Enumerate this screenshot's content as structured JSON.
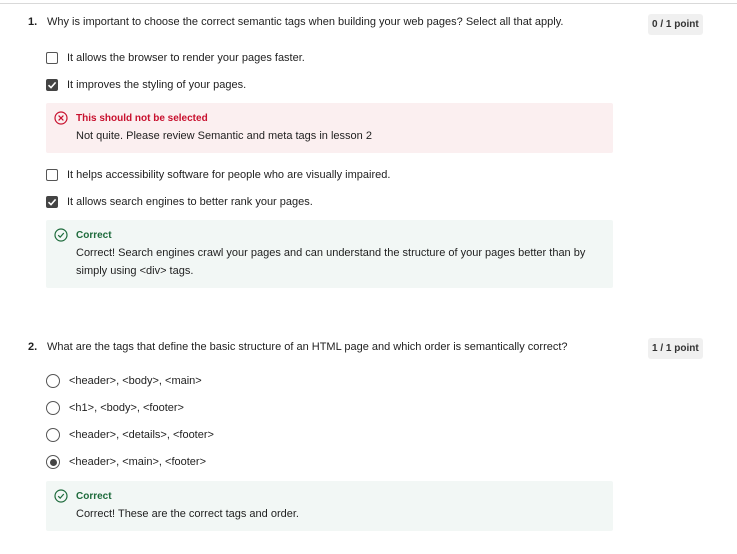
{
  "questions": [
    {
      "number": "1.",
      "text": "Why is important to choose the correct semantic tags when building your web pages? Select all that apply.",
      "points": "0 / 1 point",
      "type": "checkbox",
      "options": [
        {
          "label": "It allows the browser to render your pages faster.",
          "checked": false
        },
        {
          "label": "It improves the styling of your pages.",
          "checked": true
        },
        {
          "label": "It helps accessibility software for people who are visually impaired.",
          "checked": false
        },
        {
          "label": "It allows search engines to better rank your pages.",
          "checked": true
        }
      ],
      "feedback": [
        {
          "status": "incorrect",
          "icon": "x-circle-icon",
          "title": "This should not be selected",
          "message": "Not quite. Please review Semantic and meta tags in lesson 2"
        },
        {
          "status": "correct",
          "icon": "check-circle-icon",
          "title": "Correct",
          "message": "Correct! Search engines crawl your pages and can understand the structure of your pages better than by simply using <div> tags."
        }
      ]
    },
    {
      "number": "2.",
      "text": "What are the tags that define the basic structure of an HTML page and which order is semantically correct?",
      "points": "1 / 1 point",
      "type": "radio",
      "options": [
        {
          "label": "<header>, <body>, <main>",
          "selected": false
        },
        {
          "label": "<h1>, <body>, <footer>",
          "selected": false
        },
        {
          "label": "<header>, <details>, <footer>",
          "selected": false
        },
        {
          "label": "<header>, <main>, <footer>",
          "selected": true
        }
      ],
      "feedback": [
        {
          "status": "correct",
          "icon": "check-circle-icon",
          "title": "Correct",
          "message": "Correct! These are the correct tags and order."
        }
      ]
    }
  ],
  "colors": {
    "incorrect": "#c8102e",
    "correct": "#1e6b3c",
    "incorrect_bg": "#fbeff0",
    "correct_bg": "#f2f7f5"
  }
}
